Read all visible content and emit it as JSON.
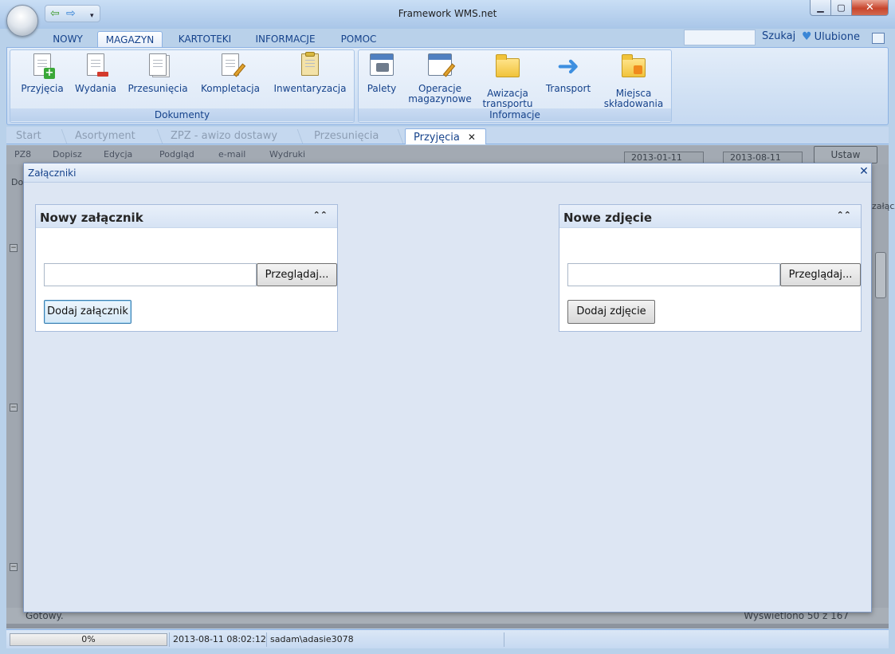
{
  "window": {
    "title": "Framework WMS.net",
    "minimize_icon": "minimize-icon",
    "maximize_icon": "maximize-icon",
    "close_glyph": "✕"
  },
  "quick_access": {
    "back_glyph": "⇦",
    "forward_glyph": "⇨",
    "dropdown_glyph": "▾"
  },
  "ribbon_tabs": [
    "NOWY",
    "MAGAZYN",
    "KARTOTEKI",
    "INFORMACJE",
    "POMOC"
  ],
  "ribbon_active_tab": "MAGAZYN",
  "header_links": {
    "search": "Szukaj",
    "favorites": "Ulubione",
    "favorites_glyph": "♥"
  },
  "ribbon": {
    "groups": [
      {
        "label": "Dokumenty",
        "buttons": [
          {
            "label": "Przyjęcia",
            "icon": "document-add-icon"
          },
          {
            "label": "Wydania",
            "icon": "document-remove-icon"
          },
          {
            "label": "Przesunięcia",
            "icon": "documents-copy-icon"
          },
          {
            "label": "Kompletacja",
            "icon": "document-edit-icon"
          },
          {
            "label": "Inwentaryzacja",
            "icon": "clipboard-icon"
          }
        ]
      },
      {
        "label": "Informacje",
        "buttons": [
          {
            "label": "Palety",
            "icon": "calendar-truck-icon"
          },
          {
            "label_line1": "Operacje",
            "label_line2": "magazynowe",
            "icon": "calendar-edit-icon"
          },
          {
            "label_line1": "Awizacja",
            "label_line2": "transportu",
            "icon": "folder-icon"
          },
          {
            "label": "Transport",
            "icon": "arrow-right-icon",
            "glyph": "➜"
          },
          {
            "label_line1": "Miejsca",
            "label_line2": "składowania",
            "icon": "folder-rss-icon"
          }
        ]
      }
    ]
  },
  "document_tabs": [
    {
      "label": "Start",
      "active": false
    },
    {
      "label": "Asortyment",
      "active": false
    },
    {
      "label": "ZPZ - awizo dostawy",
      "active": false
    },
    {
      "label": "Przesunięcia",
      "active": false
    },
    {
      "label": "Przyjęcia",
      "active": true,
      "close_glyph": "✕"
    }
  ],
  "background": {
    "toolbar": [
      "PZ8",
      "Dopisz",
      "Edycja",
      "Podgląd",
      "e-mail",
      "Wydruki"
    ],
    "date_from": "2013-01-11",
    "date_to": "2013-08-11",
    "apply_button": "Ustaw",
    "column_start": "Do",
    "column_end": "załącz",
    "status_left": "Gotowy.",
    "status_right": "Wyświetlono 50 z 167"
  },
  "dialog": {
    "title": "Załączniki",
    "close_glyph": "✕",
    "panels": [
      {
        "title": "Nowy załącznik",
        "collapse_glyph": "⌃⌃",
        "file_value": "",
        "browse_label": "Przeglądaj...",
        "add_label": "Dodaj załącznik"
      },
      {
        "title": "Nowe zdjęcie",
        "collapse_glyph": "⌃⌃",
        "file_value": "",
        "browse_label": "Przeglądaj...",
        "add_label": "Dodaj zdjęcie"
      }
    ]
  },
  "status_bar": {
    "progress_percent": 0,
    "progress_label": "0%",
    "datetime": "2013-08-11 08:02:12",
    "user": "sadam\\adasie3078"
  }
}
